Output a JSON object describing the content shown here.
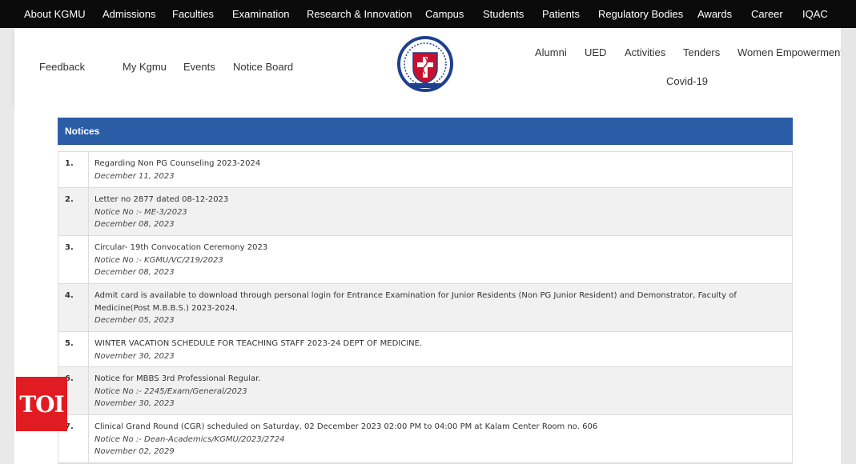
{
  "top_nav": {
    "items": [
      "About KGMU",
      "Admissions",
      "Faculties",
      "Examination",
      "Research & Innovation",
      "Campus",
      "Students",
      "Patients",
      "Regulatory Bodies",
      "Awards",
      "Career",
      "IQAC"
    ]
  },
  "header": {
    "left_links": [
      "Feedback",
      "My Kgmu",
      "Events",
      "Notice Board"
    ],
    "right_links": [
      "Alumni",
      "UED",
      "Activities",
      "Tenders",
      "Women Empowerment",
      "Covid-19"
    ]
  },
  "notices": {
    "title": "Notices",
    "rows": [
      {
        "num": "1.",
        "text": "Regarding Non PG Counseling 2023-2024",
        "notice_no": "",
        "date": "December 11, 2023"
      },
      {
        "num": "2.",
        "text": "Letter no 2877 dated 08-12-2023",
        "notice_no": "Notice No :- ME-3/2023",
        "date": "December 08, 2023"
      },
      {
        "num": "3.",
        "text": "Circular- 19th Convocation Ceremony 2023",
        "notice_no": "Notice No :- KGMU/VC/219/2023",
        "date": "December 08, 2023"
      },
      {
        "num": "4.",
        "text": "Admit card is available to download through personal login for Entrance Examination for Junior Residents (Non PG Junior Resident) and Demonstrator, Faculty of Medicine(Post M.B.B.S.) 2023-2024.",
        "notice_no": "",
        "date": "December 05, 2023"
      },
      {
        "num": "5.",
        "text": "WINTER VACATION SCHEDULE FOR TEACHING STAFF 2023-24 DEPT OF MEDICINE.",
        "notice_no": "",
        "date": "November 30, 2023"
      },
      {
        "num": "6.",
        "text": "Notice for MBBS 3rd Professional Regular.",
        "notice_no": "Notice No :- 2245/Exam/General/2023",
        "date": "November 30, 2023"
      },
      {
        "num": "7.",
        "text": "Clinical Grand Round (CGR) scheduled on Saturday, 02 December 2023 02:00 PM to 04:00 PM at Kalam Center Room no. 606",
        "notice_no": "Notice No :- Dean-Academics/KGMU/2023/2724",
        "date": "November 02, 2029"
      }
    ]
  },
  "watermark": {
    "text": "TOI",
    "color": "#e11b22"
  },
  "colors": {
    "nav_bg": "#0b0b0b",
    "notices_bar": "#2a5da6",
    "logo_red": "#c8102e",
    "logo_blue": "#1f3f8f"
  }
}
